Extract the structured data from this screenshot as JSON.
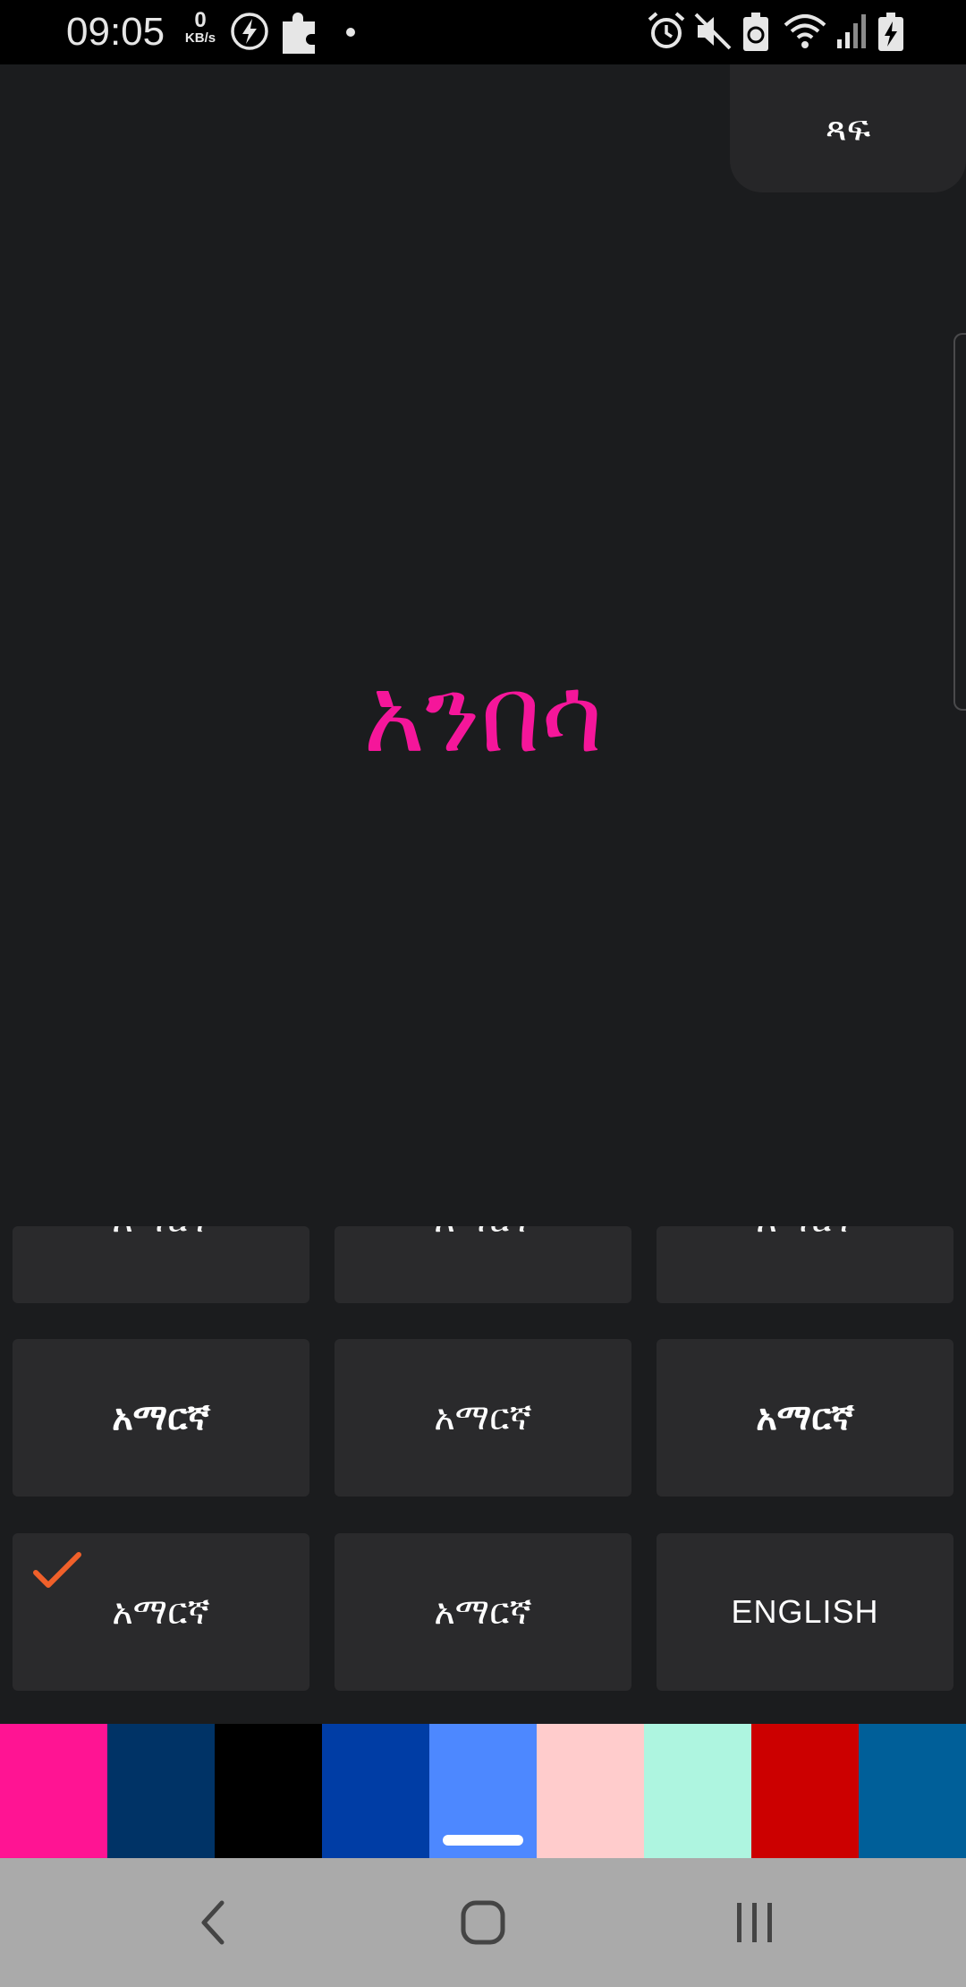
{
  "status_bar": {
    "time": "09:05",
    "net_speed_value": "0",
    "net_speed_unit": "KB/s",
    "left_icons": [
      "bolt-circle-icon",
      "puzzle-icon",
      "dot-icon"
    ],
    "right_icons": [
      "alarm-icon",
      "mute-icon",
      "battery-saver-icon",
      "wifi-icon",
      "signal-icon",
      "battery-charging-icon"
    ]
  },
  "preview": {
    "font_button_label": "ጻፍ",
    "text": "አንበሳ",
    "text_color": "#f5169a"
  },
  "font_grid": {
    "partial_row": [
      "አማርኛ",
      "አማርኛ",
      "አማርኛ"
    ],
    "row2": [
      "አማርኛ",
      "አማርኛ",
      "አማርኛ"
    ],
    "row3": [
      "አማርኛ",
      "አማርኛ",
      "ENGLISH"
    ],
    "selected_index": 6,
    "check_color": "#f0602a"
  },
  "colors": {
    "swatches": [
      "#ff1493",
      "#003366",
      "#000000",
      "#003da5",
      "#4d88ff",
      "#ffcccc",
      "#aef5e0",
      "#cc0000",
      "#005f99"
    ],
    "selected_index": 4
  },
  "nav_bar": {
    "icons": [
      "back-icon",
      "home-icon",
      "recents-icon"
    ]
  }
}
